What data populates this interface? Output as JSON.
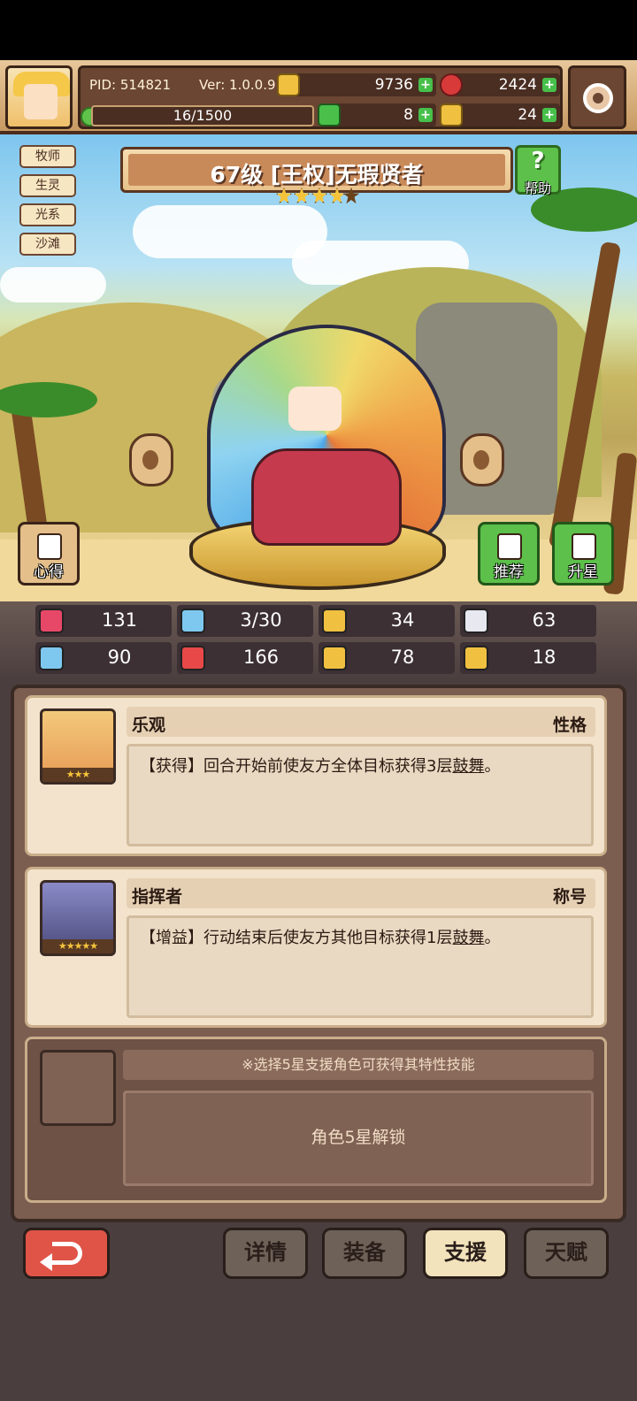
{
  "header": {
    "pid": "PID: 514821",
    "version": "Ver: 1.0.0.9",
    "gold": "9736",
    "gems": "2424",
    "exp": "16/1500",
    "clover": "8",
    "tickets": "24"
  },
  "hero": {
    "tags": [
      "牧师",
      "生灵",
      "光系",
      "沙滩"
    ],
    "title": "67级 [王权]无瑕贤者",
    "stars": 4,
    "help_label": "帮助",
    "insight_label": "心得",
    "recommend_label": "推荐",
    "starup_label": "升星"
  },
  "stats": [
    {
      "icon": "heart-icon",
      "value": "131",
      "color": "#e84868"
    },
    {
      "icon": "drop-icon",
      "value": "3/30",
      "color": "#7ec8f0"
    },
    {
      "icon": "shield-icon",
      "value": "34",
      "color": "#f0c040"
    },
    {
      "icon": "wing-icon",
      "value": "63",
      "color": "#e8e8f0"
    },
    {
      "icon": "fist-icon",
      "value": "90",
      "color": "#7ec8f0"
    },
    {
      "icon": "book-icon",
      "value": "166",
      "color": "#e84848"
    },
    {
      "icon": "boot-icon",
      "value": "78",
      "color": "#f0c040"
    },
    {
      "icon": "crown-icon",
      "value": "18",
      "color": "#f0c040"
    }
  ],
  "support": {
    "cards": [
      {
        "name": "乐观",
        "type": "性格",
        "desc_prefix": "【获得】回合开始前使友方全体目标获得3层",
        "desc_keyword": "鼓舞",
        "desc_suffix": "。",
        "stars": "★★★"
      },
      {
        "name": "指挥者",
        "type": "称号",
        "desc_prefix": "【增益】行动结束后使友方其他目标获得1层",
        "desc_keyword": "鼓舞",
        "desc_suffix": "。",
        "stars": "★★★★★"
      }
    ],
    "hint": "※选择5星支援角色可获得其特性技能",
    "locked": "角色5星解锁"
  },
  "tabs": [
    "详情",
    "装备",
    "支援",
    "天赋"
  ],
  "active_tab": "支援"
}
